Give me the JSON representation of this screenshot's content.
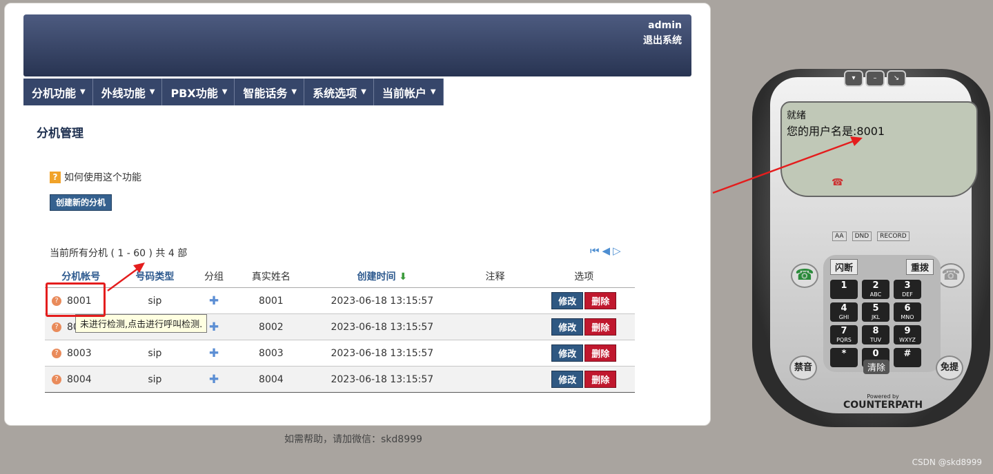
{
  "header": {
    "user": "admin",
    "logout": "退出系统"
  },
  "nav": [
    {
      "label": "分机功能"
    },
    {
      "label": "外线功能"
    },
    {
      "label": "PBX功能"
    },
    {
      "label": "智能话务"
    },
    {
      "label": "系统选项"
    },
    {
      "label": "当前帐户"
    }
  ],
  "page": {
    "title": "分机管理",
    "help_icon": "?",
    "help_text": "如何使用这个功能",
    "create_button": "创建新的分机",
    "summary": "当前所有分机 ( 1 - 60 ) 共 4 部"
  },
  "table": {
    "headers": {
      "ext": "分机帐号",
      "type": "号码类型",
      "group": "分组",
      "name": "真实姓名",
      "created": "创建时间",
      "created_arrow": "⬇",
      "note": "注释",
      "options": "选项"
    },
    "rows": [
      {
        "ext": "8001",
        "type": "sip",
        "name": "8001",
        "created": "2023-06-18 13:15:57",
        "note": ""
      },
      {
        "ext": "8002",
        "type": "sip",
        "name": "8002",
        "created": "2023-06-18 13:15:57",
        "note": ""
      },
      {
        "ext": "8003",
        "type": "sip",
        "name": "8003",
        "created": "2023-06-18 13:15:57",
        "note": ""
      },
      {
        "ext": "8004",
        "type": "sip",
        "name": "8004",
        "created": "2023-06-18 13:15:57",
        "note": ""
      }
    ],
    "edit_label": "修改",
    "delete_label": "删除"
  },
  "tooltip": "未进行检测,点击进行呼叫检测.",
  "footer": "如需帮助，请加微信：skd8999",
  "watermark": "CSDN @skd8999",
  "softphone": {
    "status": "就绪",
    "username_line": "您的用户名是:8001",
    "features": [
      "AA",
      "DND",
      "RECORD"
    ],
    "flash": "闪断",
    "redial": "重拨",
    "keys": [
      {
        "d": "1",
        "l": ""
      },
      {
        "d": "2",
        "l": "ABC"
      },
      {
        "d": "3",
        "l": "DEF"
      },
      {
        "d": "4",
        "l": "GHI"
      },
      {
        "d": "5",
        "l": "JKL"
      },
      {
        "d": "6",
        "l": "MNO"
      },
      {
        "d": "7",
        "l": "PQRS"
      },
      {
        "d": "8",
        "l": "TUV"
      },
      {
        "d": "9",
        "l": "WXYZ"
      },
      {
        "d": "*",
        "l": ""
      },
      {
        "d": "0",
        "l": ""
      },
      {
        "d": "#",
        "l": ""
      }
    ],
    "clear": "清除",
    "mute": "禁音",
    "speaker": "免提",
    "powered_by": "Powered by",
    "brand": "COUNTERPATH"
  },
  "colors": {
    "header": "#2c3858",
    "nav": "#36466a",
    "edit": "#2f5882",
    "delete": "#c0182e",
    "annotation": "#e41d1d"
  }
}
